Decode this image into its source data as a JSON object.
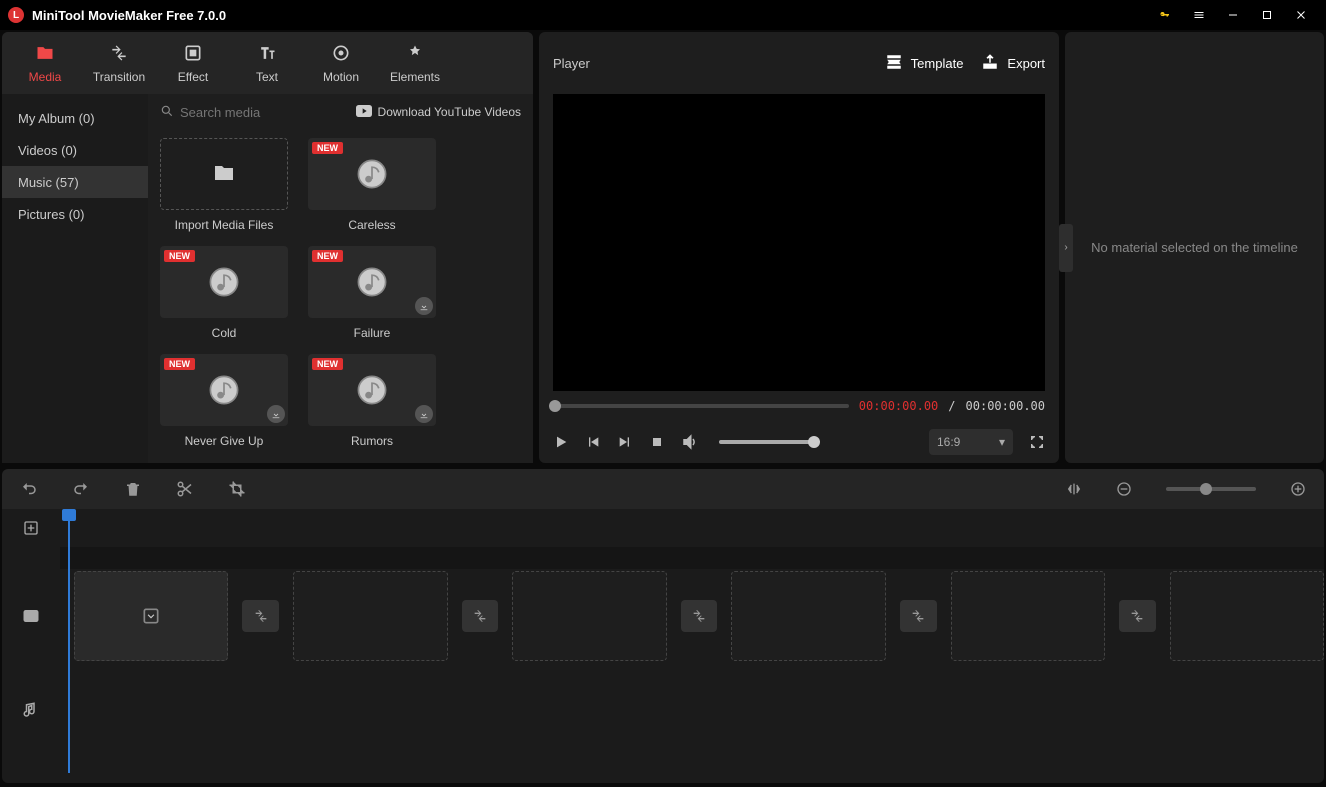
{
  "app": {
    "title": "MiniTool MovieMaker Free 7.0.0"
  },
  "toolTabs": [
    {
      "id": "media",
      "label": "Media",
      "active": true
    },
    {
      "id": "transition",
      "label": "Transition"
    },
    {
      "id": "effect",
      "label": "Effect"
    },
    {
      "id": "text",
      "label": "Text"
    },
    {
      "id": "motion",
      "label": "Motion"
    },
    {
      "id": "elements",
      "label": "Elements"
    }
  ],
  "sidebar": [
    {
      "label": "My Album (0)"
    },
    {
      "label": "Videos (0)"
    },
    {
      "label": "Music (57)",
      "active": true
    },
    {
      "label": "Pictures (0)"
    }
  ],
  "search": {
    "placeholder": "Search media"
  },
  "downloadYT": "Download YouTube Videos",
  "mediaItems": [
    {
      "label": "Import Media Files",
      "import": true
    },
    {
      "label": "Careless",
      "new": true
    },
    {
      "label": "Cold",
      "new": true
    },
    {
      "label": "Failure",
      "new": true,
      "download": true
    },
    {
      "label": "Never Give Up",
      "new": true,
      "download": true
    },
    {
      "label": "Rumors",
      "new": true,
      "download": true
    }
  ],
  "newBadge": "NEW",
  "player": {
    "title": "Player",
    "templateBtn": "Template",
    "exportBtn": "Export",
    "timeCurrent": "00:00:00.00",
    "timeSep": "/",
    "timeTotal": "00:00:00.00",
    "ratio": "16:9"
  },
  "infoPanel": {
    "empty": "No material selected on the timeline"
  }
}
